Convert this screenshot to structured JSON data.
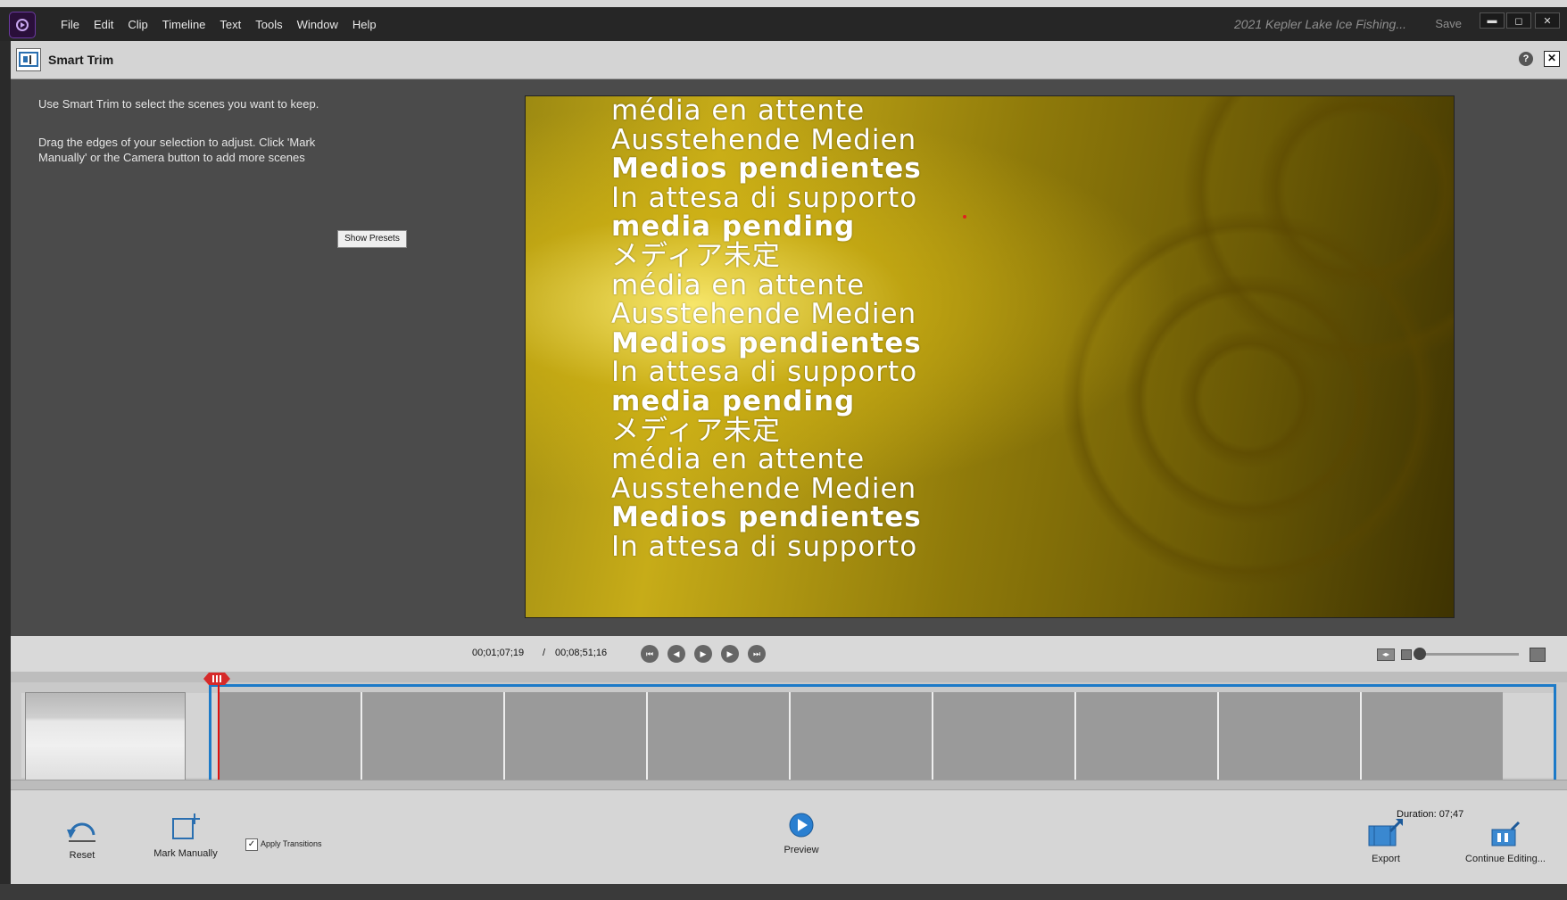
{
  "window": {
    "project_title": "2021 Kepler Lake Ice Fishing...",
    "save_label": "Save",
    "minimize": "▬",
    "maximize": "◻",
    "close": "✕"
  },
  "menu": [
    "File",
    "Edit",
    "Clip",
    "Timeline",
    "Text",
    "Tools",
    "Window",
    "Help"
  ],
  "panel": {
    "title": "Smart Trim",
    "help": "?",
    "close": "✕"
  },
  "instructions": {
    "line1": "Use Smart Trim to select the scenes you want to keep.",
    "line2": "Drag the edges of your selection to adjust. Click 'Mark Manually' or the Camera button to add more scenes"
  },
  "show_presets_label": "Show Presets",
  "preview": {
    "lines": [
      {
        "text": "média en attente",
        "bold": false
      },
      {
        "text": "Ausstehende Medien",
        "bold": false
      },
      {
        "text": "Medios pendientes",
        "bold": true
      },
      {
        "text": "In attesa di supporto",
        "bold": false
      },
      {
        "text": "media pending",
        "bold": true
      },
      {
        "text": "メディア未定",
        "bold": false
      },
      {
        "text": "média en attente",
        "bold": false
      },
      {
        "text": "Ausstehende Medien",
        "bold": false
      },
      {
        "text": "Medios pendientes",
        "bold": true
      },
      {
        "text": "In attesa di supporto",
        "bold": false
      },
      {
        "text": "media pending",
        "bold": true
      },
      {
        "text": "メディア未定",
        "bold": false
      },
      {
        "text": "média en attente",
        "bold": false
      },
      {
        "text": "Ausstehende Medien",
        "bold": false
      },
      {
        "text": "Medios pendientes",
        "bold": true
      },
      {
        "text": "In attesa di supporto",
        "bold": false
      }
    ]
  },
  "transport": {
    "current_timecode": "00;01;07;19",
    "separator": "/",
    "total_timecode": "00;08;51;16",
    "buttons": [
      "⏮",
      "◀",
      "▶",
      "▶",
      "⏭"
    ]
  },
  "timeline": {
    "frame_count": 9
  },
  "bottom": {
    "duration": "Duration: 07;47",
    "reset_label": "Reset",
    "mark_manually_label": "Mark Manually",
    "apply_transitions_label": "Apply Transitions",
    "apply_transitions_checked": true,
    "preview_label": "Preview",
    "export_label": "Export",
    "continue_label": "Continue Editing..."
  },
  "colors": {
    "selection": "#1c7ac8",
    "playhead": "#dd1111"
  }
}
